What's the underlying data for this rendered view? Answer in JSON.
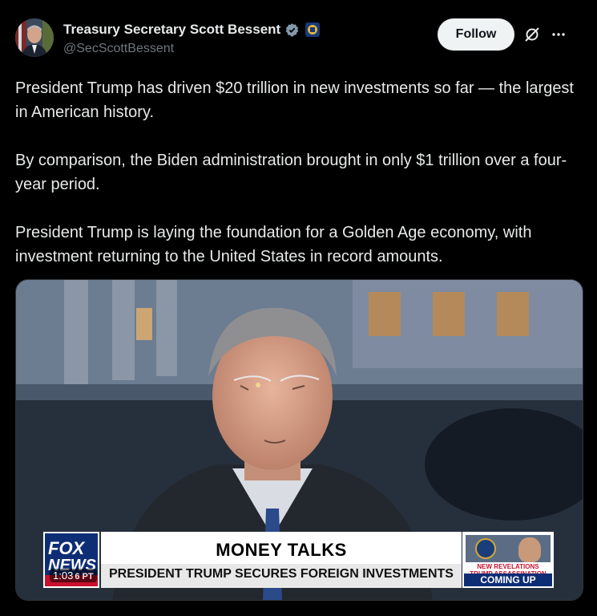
{
  "author": {
    "display_name": "Treasury Secretary Scott Bessent",
    "handle": "@SecScottBessent",
    "verified_icon": "verified-badge-icon",
    "affiliate_icon": "treasury-seal-icon"
  },
  "actions": {
    "follow_label": "Follow",
    "grok_icon": "grok-icon",
    "more_icon": "more-icon"
  },
  "tweet": {
    "paragraphs": [
      "President Trump has driven $20 trillion in new investments so far — the largest in American history.",
      "By comparison, the Biden administration brought in only $1 trillion over a four-year period.",
      "President Trump is laying the foundation for a Golden Age economy, with investment returning to the United States in record amounts."
    ]
  },
  "media": {
    "timestamp": "1:03",
    "chyron": {
      "network_top": "FOX",
      "network_bottom": "NEWS",
      "time_fragment": "6 PT",
      "headline": "MONEY TALKS",
      "subheadline": "PRESIDENT TRUMP SECURES FOREIGN INVESTMENTS",
      "promo_line1": "NEW REVELATIONS",
      "promo_line2": "TRUMP ASSASSINATION ATTEMPT",
      "promo_cta": "COMING UP"
    }
  },
  "colors": {
    "background": "#000000",
    "text": "#e7e9ea",
    "secondary_text": "#71767b",
    "verified": "#829aab",
    "fox_blue": "#0d2d75",
    "fox_red": "#c8102e"
  }
}
